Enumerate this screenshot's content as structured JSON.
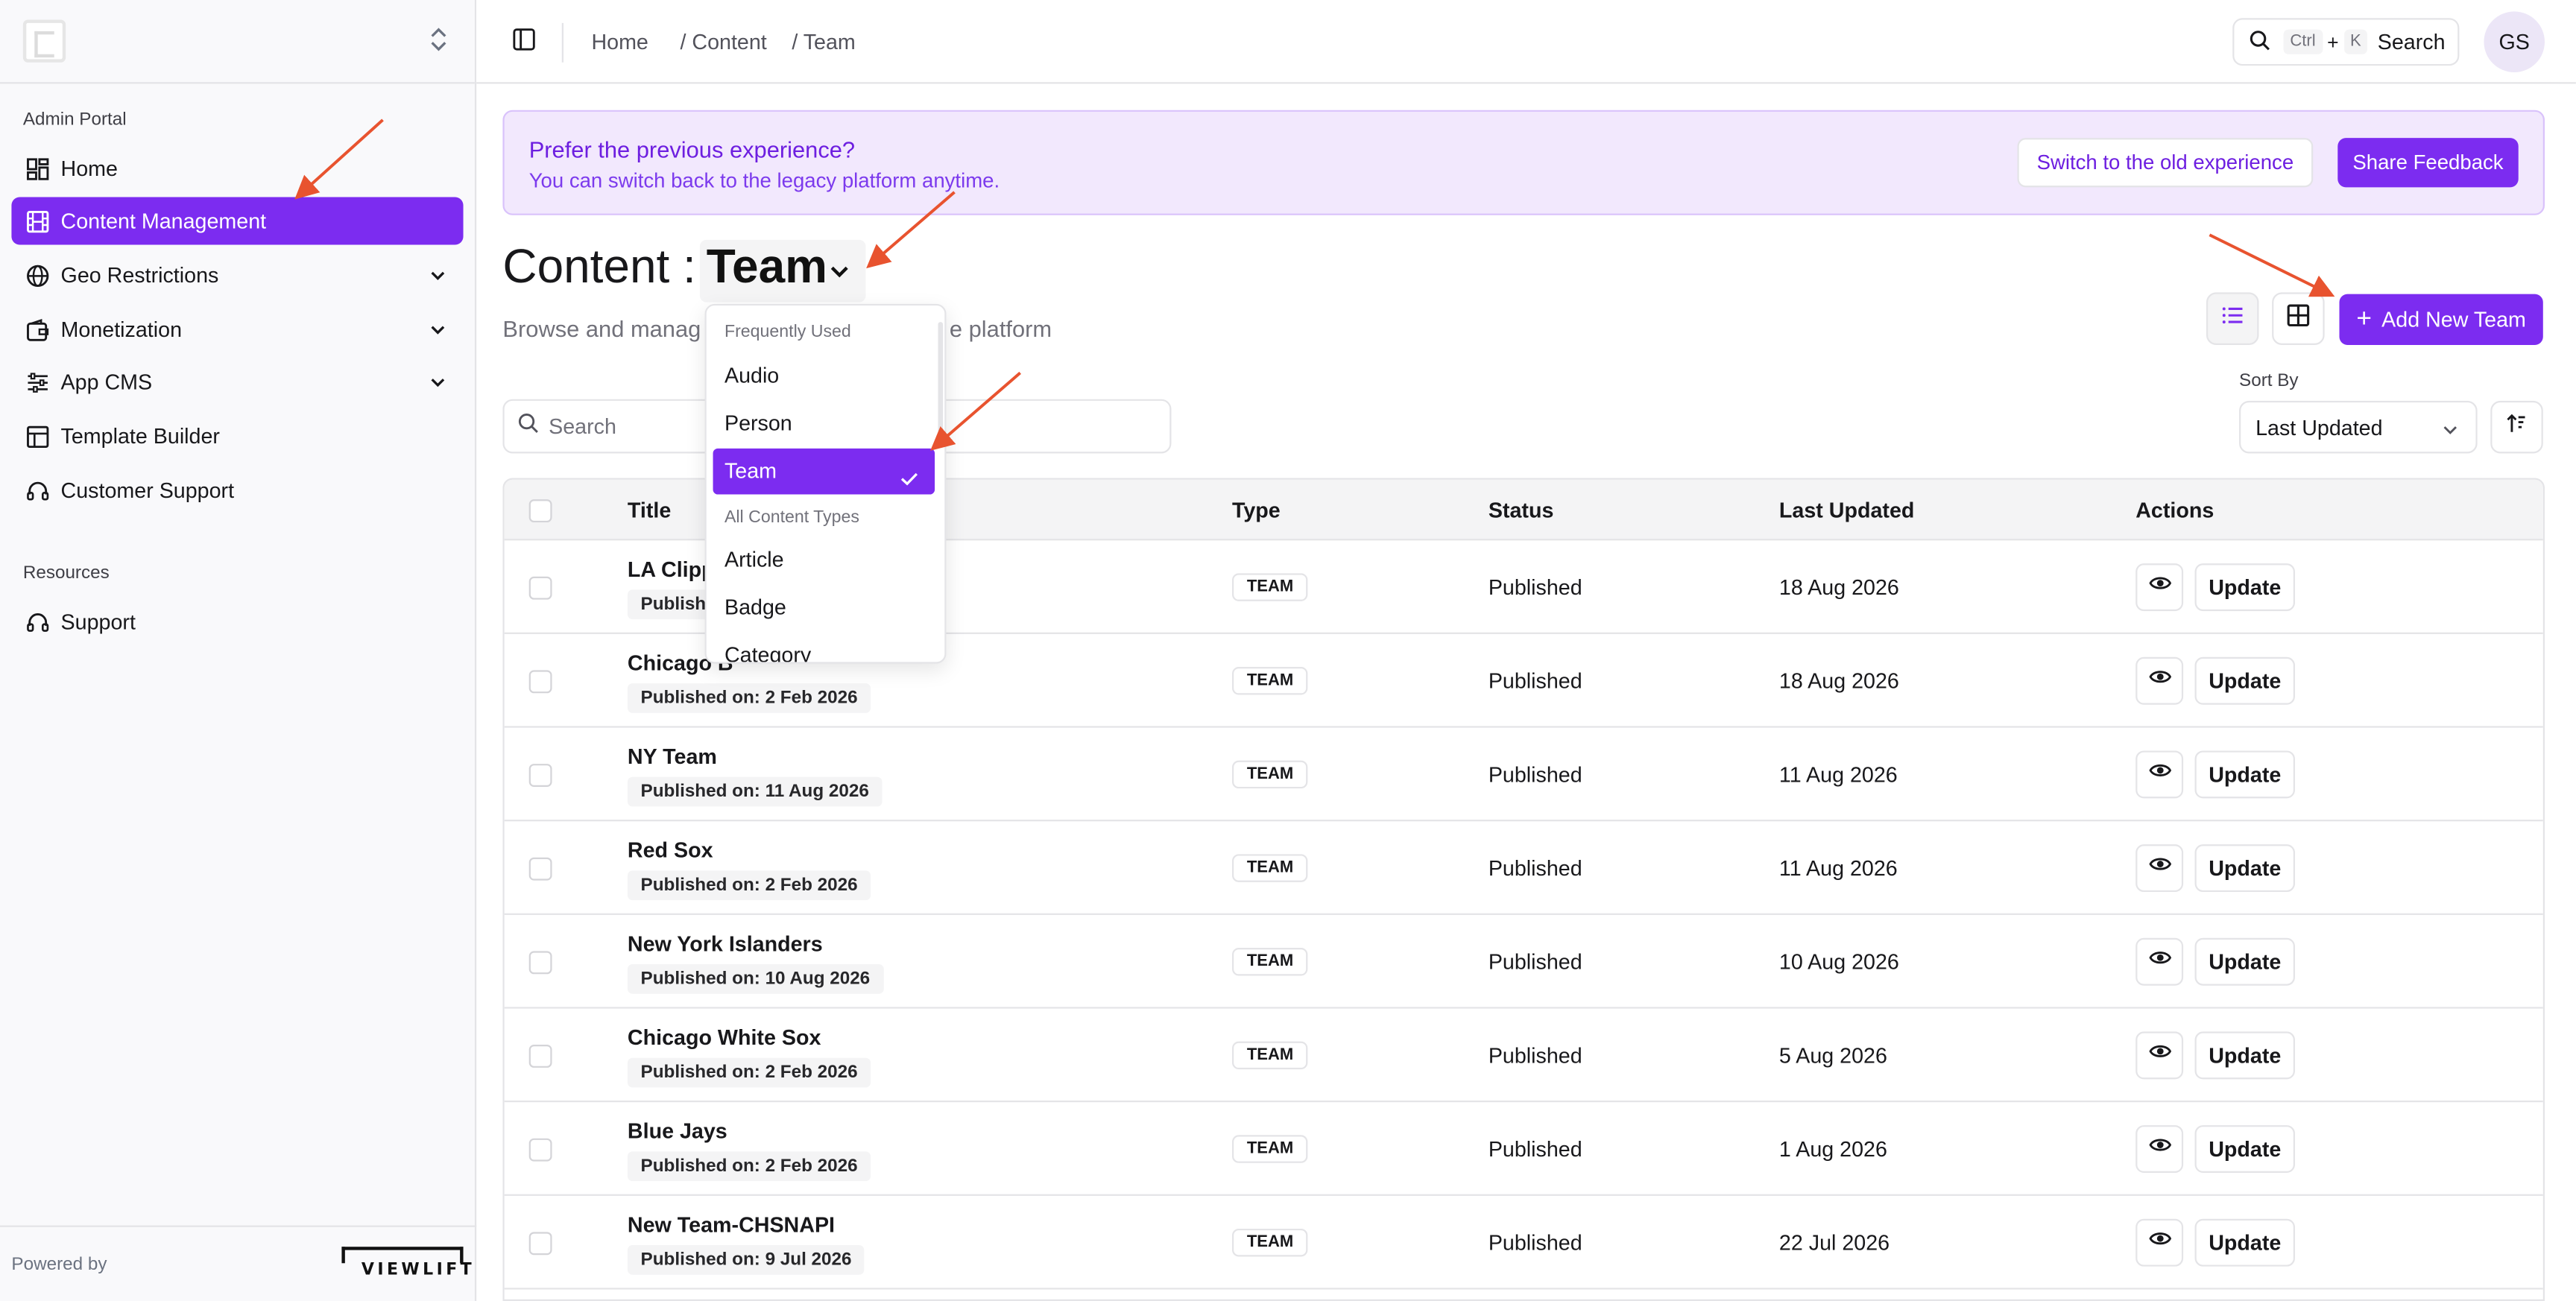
{
  "sidebar": {
    "admin_label": "Admin Portal",
    "items": [
      {
        "label": "Home"
      },
      {
        "label": "Content Management"
      },
      {
        "label": "Geo Restrictions"
      },
      {
        "label": "Monetization"
      },
      {
        "label": "App CMS"
      },
      {
        "label": "Template Builder"
      },
      {
        "label": "Customer Support"
      }
    ],
    "resources_label": "Resources",
    "resources_items": [
      {
        "label": "Support"
      }
    ],
    "powered_by": "Powered by",
    "brand": "VIEWLIFT"
  },
  "topbar": {
    "breadcrumb": [
      "Home",
      "/ Content",
      "/ Team"
    ],
    "search_kbd_1": "Ctrl",
    "search_plus": "+",
    "search_kbd_2": "K",
    "search_label": "Search",
    "avatar": "GS"
  },
  "banner": {
    "title": "Prefer the previous experience?",
    "subtitle": "You can switch back to the legacy platform anytime.",
    "switch_button": "Switch to the old experience",
    "feedback_button": "Share Feedback"
  },
  "heading": {
    "title": "Content :",
    "selected_type": "Team",
    "subtitle": "Browse and manag",
    "subtitle_tail": "e platform",
    "add_button": "Add New Team"
  },
  "filters": {
    "search_placeholder": "Search",
    "sort_label": "Sort By",
    "sort_value": "Last Updated"
  },
  "dropdown": {
    "group_frequent": "Frequently Used",
    "frequent": [
      "Audio",
      "Person",
      "Team"
    ],
    "group_all": "All Content Types",
    "all": [
      "Article",
      "Badge",
      "Category"
    ]
  },
  "table": {
    "headers": {
      "title": "Title",
      "type": "Type",
      "status": "Status",
      "updated": "Last Updated",
      "actions": "Actions"
    },
    "update_label": "Update",
    "rows": [
      {
        "title": "LA Clipp",
        "published": "Publishe",
        "type": "TEAM",
        "status": "Published",
        "updated": "18 Aug 2026"
      },
      {
        "title": "Chicago B",
        "published": "Published on: 2 Feb 2026",
        "type": "TEAM",
        "status": "Published",
        "updated": "18 Aug 2026"
      },
      {
        "title": "NY Team",
        "published": "Published on: 11 Aug 2026",
        "type": "TEAM",
        "status": "Published",
        "updated": "11 Aug 2026"
      },
      {
        "title": "Red Sox",
        "published": "Published on: 2 Feb 2026",
        "type": "TEAM",
        "status": "Published",
        "updated": "11 Aug 2026"
      },
      {
        "title": "New York Islanders",
        "published": "Published on: 10 Aug 2026",
        "type": "TEAM",
        "status": "Published",
        "updated": "10 Aug 2026"
      },
      {
        "title": "Chicago White Sox",
        "published": "Published on: 2 Feb 2026",
        "type": "TEAM",
        "status": "Published",
        "updated": "5 Aug 2026"
      },
      {
        "title": "Blue Jays",
        "published": "Published on: 2 Feb 2026",
        "type": "TEAM",
        "status": "Published",
        "updated": "1 Aug 2026"
      },
      {
        "title": "New Team-CHSNAPI",
        "published": "Published on: 9 Jul 2026",
        "type": "TEAM",
        "status": "Published",
        "updated": "22 Jul 2026"
      }
    ]
  },
  "colors": {
    "accent": "#7c2cf0",
    "banner_bg": "#f2e8fd",
    "annotation_arrow": "#e8532f"
  }
}
